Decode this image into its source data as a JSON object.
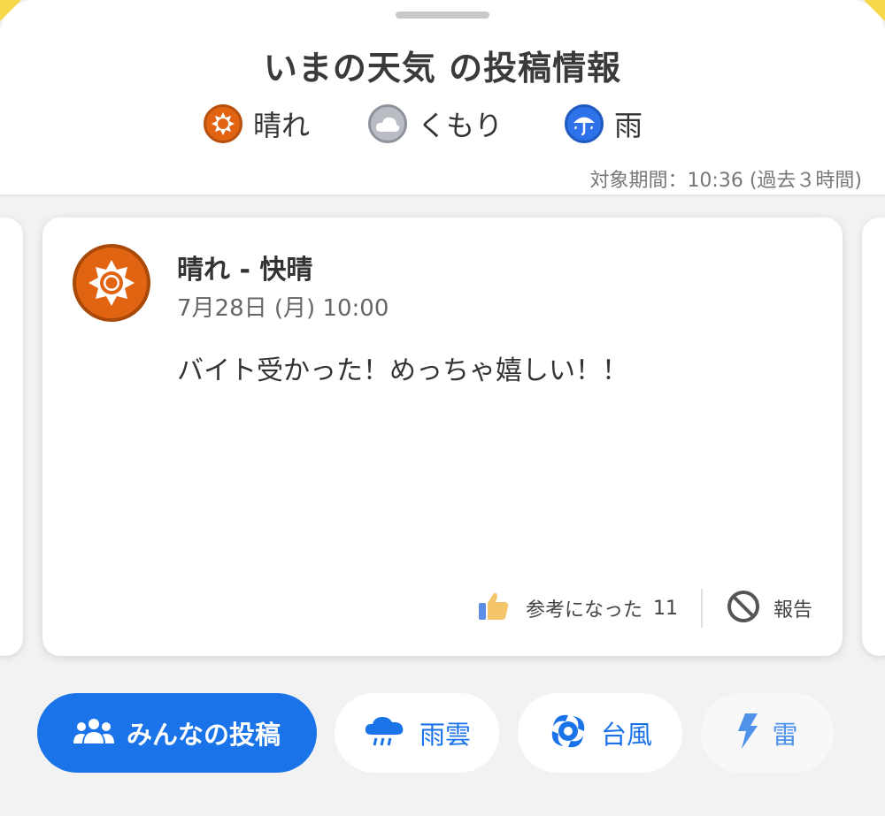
{
  "header": {
    "title": "いまの天気 の投稿情報",
    "legend": [
      {
        "label": "晴れ",
        "icon": "sun-icon"
      },
      {
        "label": "くもり",
        "icon": "cloud-icon"
      },
      {
        "label": "雨",
        "icon": "umbrella-icon"
      }
    ],
    "period": "対象期間：10:36 (過去３時間)"
  },
  "post": {
    "title": "晴れ - 快晴",
    "date": "7月28日 (月) 10:00",
    "body": "バイト受かった！めっちゃ嬉しい！！",
    "helpful_label": "参考になった",
    "helpful_count": "11",
    "report_label": "報告",
    "icon": "sun-icon"
  },
  "chips": [
    {
      "label": "みんなの投稿",
      "icon": "people-icon",
      "active": true
    },
    {
      "label": "雨雲",
      "icon": "rain-cloud-icon",
      "active": false
    },
    {
      "label": "台風",
      "icon": "typhoon-icon",
      "active": false
    },
    {
      "label": "雷",
      "icon": "lightning-icon",
      "active": false
    }
  ],
  "colors": {
    "accent": "#1a73e8",
    "sun": "#e06412",
    "cloud": "#b9bcc3",
    "rain": "#2d72e8"
  }
}
